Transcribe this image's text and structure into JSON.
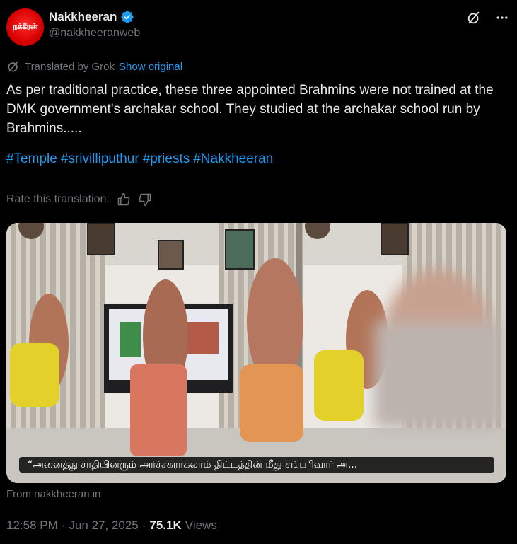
{
  "author": {
    "avatar_text": "நக்கீரன்",
    "display_name": "Nakkheeran",
    "handle": "@nakkheeranweb"
  },
  "translation": {
    "label": "Translated by Grok",
    "show_original": "Show original"
  },
  "tweet": {
    "text": "As per traditional practice, these three appointed Brahmins were not trained at the DMK government's archakar school. They studied at the archakar school run by Brahmins.....",
    "hashtags": [
      "#Temple",
      "#srivilliputhur",
      "#priests",
      "#Nakkheeran"
    ]
  },
  "rate": {
    "label": "Rate this translation:"
  },
  "card": {
    "caption": "“அனைத்து சாதியினரும் அர்ச்சகராகலாம் திட்டத்தின் மீது சங்பரிவார் அ...",
    "source": "From nakkheeran.in"
  },
  "meta": {
    "time": "12:58 PM",
    "separator": "·",
    "date": "Jun 27, 2025",
    "views_count": "75.1K",
    "views_label": "Views"
  },
  "colors": {
    "background": "#000000",
    "text": "#e7e9ea",
    "muted": "#71767b",
    "link": "#1d9bf0",
    "verified": "#1d9bf0"
  },
  "icons": {
    "grok": "grok-icon",
    "more": "more-icon",
    "translate": "grok-translate-icon",
    "thumbs_up": "thumbs-up-icon",
    "thumbs_down": "thumbs-down-icon",
    "verified": "verified-badge-icon"
  }
}
